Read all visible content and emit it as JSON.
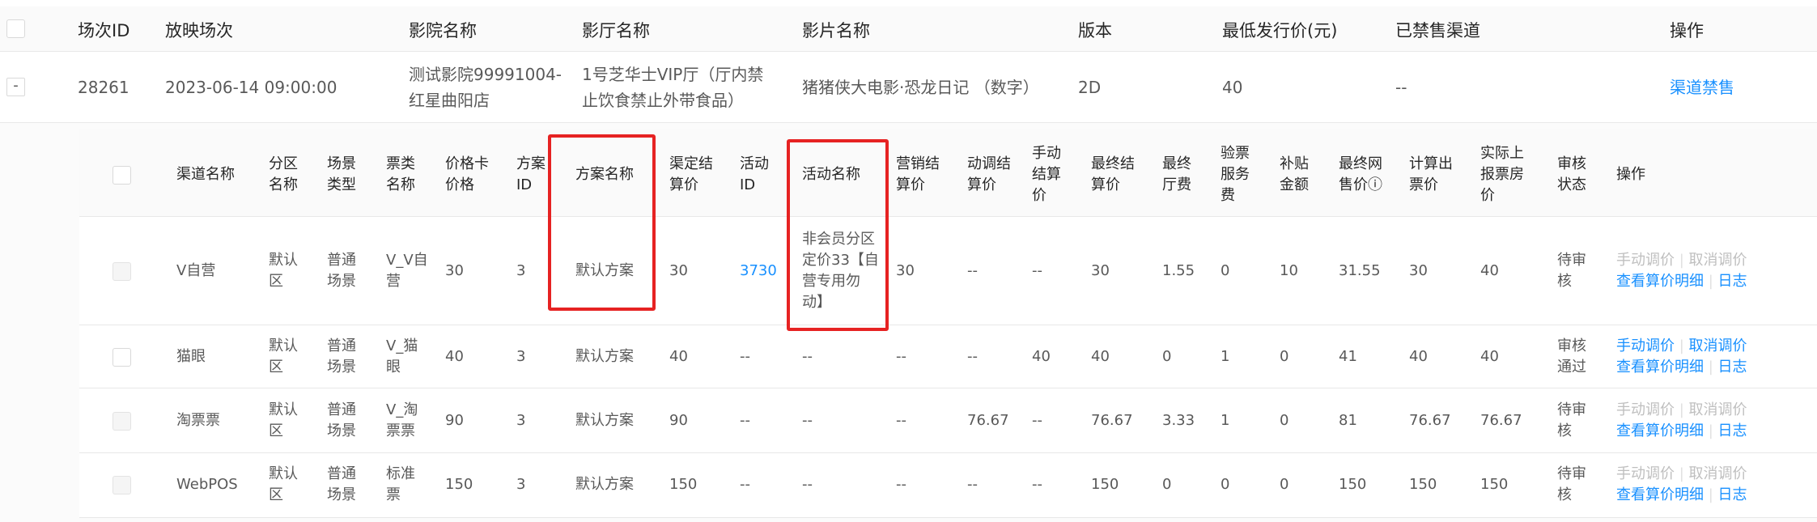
{
  "outer_table": {
    "headers": {
      "session_id": "场次ID",
      "screening": "放映场次",
      "cinema": "影院名称",
      "hall": "影厅名称",
      "film": "影片名称",
      "version": "版本",
      "min_price": "最低发行价(元)",
      "banned_channels": "已禁售渠道",
      "action": "操作"
    },
    "row": {
      "expand_symbol": "-",
      "session_id": "28261",
      "screening": "2023-06-14 09:00:00",
      "cinema_line1": "测试影院99991004-",
      "cinema_line2": "红星曲阳店",
      "hall_line1": "1号芝华士VIP厅（厅内禁",
      "hall_line2": "止饮食禁止外带食品）",
      "film": "猪猪侠大电影·恐龙日记 （数字）",
      "version": "2D",
      "min_price": "40",
      "banned_channels": "--",
      "action": "渠道禁售"
    }
  },
  "inner_table": {
    "headers": {
      "channel": "渠道名称",
      "zone_1": "分区",
      "zone_2": "名称",
      "scene_1": "场景",
      "scene_2": "类型",
      "ticket_1": "票类",
      "ticket_2": "名称",
      "card_1": "价格卡",
      "card_2": "价格",
      "plan_id_1": "方案",
      "plan_id_2": "ID",
      "plan_name": "方案名称",
      "channel_settle_1": "渠定结",
      "channel_settle_2": "算价",
      "activity_id_1": "活动",
      "activity_id_2": "ID",
      "activity_name": "活动名称",
      "marketing_1": "营销结",
      "marketing_2": "算价",
      "dynamic_1": "动调结",
      "dynamic_2": "算价",
      "manual_1": "手动",
      "manual_2": "结算",
      "manual_3": "价",
      "final_settle_1": "最终结",
      "final_settle_2": "算价",
      "final_hall_1": "最终",
      "final_hall_2": "厅费",
      "verify_1": "验票",
      "verify_2": "服务",
      "verify_3": "费",
      "subsidy_1": "补贴",
      "subsidy_2": "金额",
      "final_online_1": "最终网",
      "final_online_2": "售价",
      "info_icon": "ⓘ",
      "calc_out_1": "计算出",
      "calc_out_2": "票价",
      "actual_1": "实际上",
      "actual_2": "报票房",
      "actual_3": "价",
      "audit_1": "审核",
      "audit_2": "状态",
      "action": "操作"
    },
    "rows": [
      {
        "channel": "V自营",
        "zone_1": "默认",
        "zone_2": "区",
        "scene_1": "普通",
        "scene_2": "场景",
        "ticket_1": "V_V自",
        "ticket_2": "营",
        "card": "30",
        "plan_id": "3",
        "plan_name": "默认方案",
        "channel_settle": "30",
        "activity_id": "3730",
        "activity_1": "非会员分区",
        "activity_2": "定价33【自",
        "activity_3": "营专用勿",
        "activity_4": "动】",
        "marketing": "30",
        "dynamic": "--",
        "manual": "--",
        "final_settle": "30",
        "final_hall": "1.55",
        "verify": "0",
        "subsidy": "10",
        "final_online": "31.55",
        "calc_out": "30",
        "actual": "40",
        "audit_1": "待审",
        "audit_2": "核",
        "act_manual": "手动调价",
        "act_cancel": "取消调价",
        "act_detail": "查看算价明细",
        "act_log": "日志"
      },
      {
        "channel": "猫眼",
        "zone_1": "默认",
        "zone_2": "区",
        "scene_1": "普通",
        "scene_2": "场景",
        "ticket_1": "V_猫",
        "ticket_2": "眼",
        "card": "40",
        "plan_id": "3",
        "plan_name": "默认方案",
        "channel_settle": "40",
        "activity_id": "--",
        "activity": "--",
        "marketing": "--",
        "dynamic": "--",
        "manual": "40",
        "final_settle": "40",
        "final_hall": "0",
        "verify": "1",
        "subsidy": "0",
        "final_online": "41",
        "calc_out": "40",
        "actual": "40",
        "audit_1": "审核",
        "audit_2": "通过",
        "act_manual": "手动调价",
        "act_cancel": "取消调价",
        "act_detail": "查看算价明细",
        "act_log": "日志"
      },
      {
        "channel": "淘票票",
        "zone_1": "默认",
        "zone_2": "区",
        "scene_1": "普通",
        "scene_2": "场景",
        "ticket_1": "V_淘",
        "ticket_2": "票票",
        "card": "90",
        "plan_id": "3",
        "plan_name": "默认方案",
        "channel_settle": "90",
        "activity_id": "--",
        "activity": "--",
        "marketing": "--",
        "dynamic": "76.67",
        "manual": "--",
        "final_settle": "76.67",
        "final_hall": "3.33",
        "verify": "1",
        "subsidy": "0",
        "final_online": "81",
        "calc_out": "76.67",
        "actual": "76.67",
        "audit_1": "待审",
        "audit_2": "核",
        "act_manual": "手动调价",
        "act_cancel": "取消调价",
        "act_detail": "查看算价明细",
        "act_log": "日志"
      },
      {
        "channel": "WebPOS",
        "zone_1": "默认",
        "zone_2": "区",
        "scene_1": "普通",
        "scene_2": "场景",
        "ticket_1": "标准",
        "ticket_2": "票",
        "card": "150",
        "plan_id": "3",
        "plan_name": "默认方案",
        "channel_settle": "150",
        "activity_id": "--",
        "activity": "--",
        "marketing": "--",
        "dynamic": "--",
        "manual": "--",
        "final_settle": "150",
        "final_hall": "0",
        "verify": "0",
        "subsidy": "0",
        "final_online": "150",
        "calc_out": "150",
        "actual": "150",
        "audit_1": "待审",
        "audit_2": "核",
        "act_manual": "手动调价",
        "act_cancel": "取消调价",
        "act_detail": "查看算价明细",
        "act_log": "日志"
      }
    ]
  },
  "colors": {
    "link": "#1890ff",
    "disabled_link": "#bfbfbf",
    "highlight_box": "#e62222",
    "header_bg": "#fafafa",
    "border": "#e8e8e8"
  }
}
